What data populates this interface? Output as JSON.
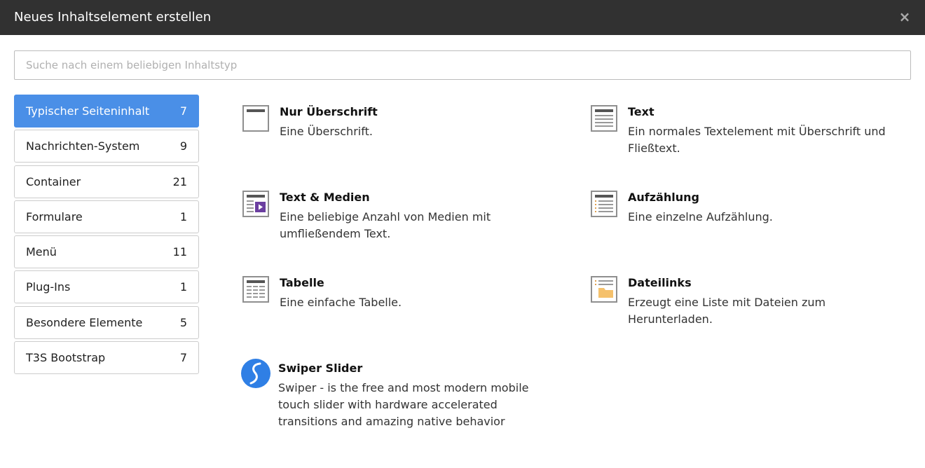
{
  "modal": {
    "title": "Neues Inhaltselement erstellen",
    "close": "×"
  },
  "search": {
    "placeholder": "Suche nach einem beliebigen Inhaltstyp",
    "value": ""
  },
  "categories": [
    {
      "label": "Typischer Seiteninhalt",
      "count": "7",
      "active": true
    },
    {
      "label": "Nachrichten-System",
      "count": "9",
      "active": false
    },
    {
      "label": "Container",
      "count": "21",
      "active": false
    },
    {
      "label": "Formulare",
      "count": "1",
      "active": false
    },
    {
      "label": "Menü",
      "count": "11",
      "active": false
    },
    {
      "label": "Plug-Ins",
      "count": "1",
      "active": false
    },
    {
      "label": "Besondere Elemente",
      "count": "5",
      "active": false
    },
    {
      "label": "T3S Bootstrap",
      "count": "7",
      "active": false
    }
  ],
  "elements": [
    {
      "title": "Nur Überschrift",
      "desc_lines": [
        "Eine Überschrift."
      ],
      "icon": "header-icon"
    },
    {
      "title": "Text",
      "desc_lines": [
        "Ein normales Textelement mit Überschrift und",
        "Fließtext."
      ],
      "icon": "text-icon"
    },
    {
      "title": "Text & Medien",
      "desc_lines": [
        "Eine beliebige Anzahl von Medien mit",
        "umfließendem Text."
      ],
      "icon": "textmedia-icon"
    },
    {
      "title": "Aufzählung",
      "desc_lines": [
        "Eine einzelne Aufzählung."
      ],
      "icon": "bullets-icon"
    },
    {
      "title": "Tabelle",
      "desc_lines": [
        "Eine einfache Tabelle."
      ],
      "icon": "table-icon"
    },
    {
      "title": "Dateilinks",
      "desc_lines": [
        "Erzeugt eine Liste mit Dateien zum",
        "Herunterladen."
      ],
      "icon": "filelinks-icon"
    },
    {
      "title": "Swiper Slider",
      "desc_lines": [
        "Swiper - is the free and most modern mobile",
        "touch slider with hardware accelerated",
        "transitions and amazing native behavior"
      ],
      "icon": "swiper-icon"
    }
  ],
  "colors": {
    "header_bg": "#313131",
    "active_category": "#4a8fe7",
    "swiper_blue": "#2f7fe5",
    "media_purple": "#6b3fa0",
    "folder_yellow": "#f5c16c"
  }
}
